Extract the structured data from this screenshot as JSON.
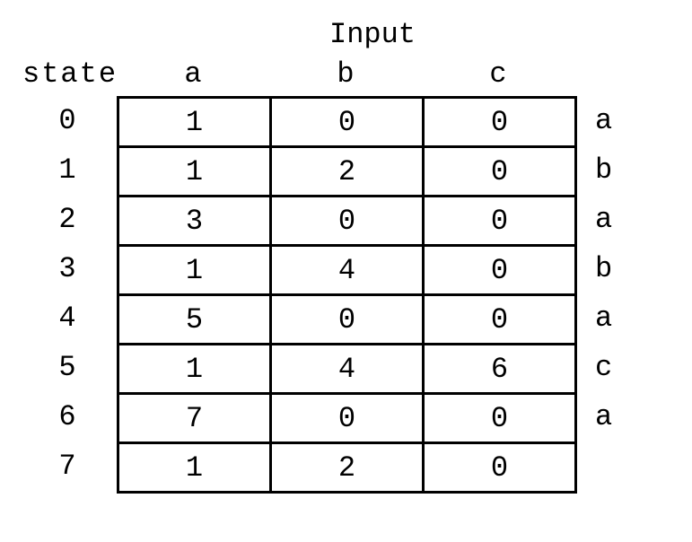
{
  "chart_data": {
    "type": "table",
    "title": "Input",
    "row_header_label": "state",
    "columns": [
      "a",
      "b",
      "c"
    ],
    "states": [
      "0",
      "1",
      "2",
      "3",
      "4",
      "5",
      "6",
      "7"
    ],
    "transitions": [
      [
        "1",
        "0",
        "0"
      ],
      [
        "1",
        "2",
        "0"
      ],
      [
        "3",
        "0",
        "0"
      ],
      [
        "1",
        "4",
        "0"
      ],
      [
        "5",
        "0",
        "0"
      ],
      [
        "1",
        "4",
        "6"
      ],
      [
        "7",
        "0",
        "0"
      ],
      [
        "1",
        "2",
        "0"
      ]
    ],
    "right_labels": [
      "a",
      "b",
      "a",
      "b",
      "a",
      "c",
      "a",
      ""
    ]
  }
}
